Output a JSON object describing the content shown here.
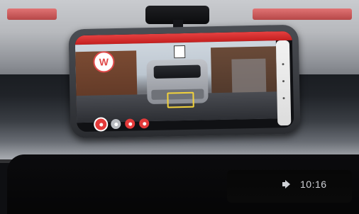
{
  "status": {
    "time": "10:16"
  },
  "app": {
    "logo_letter": "W"
  }
}
